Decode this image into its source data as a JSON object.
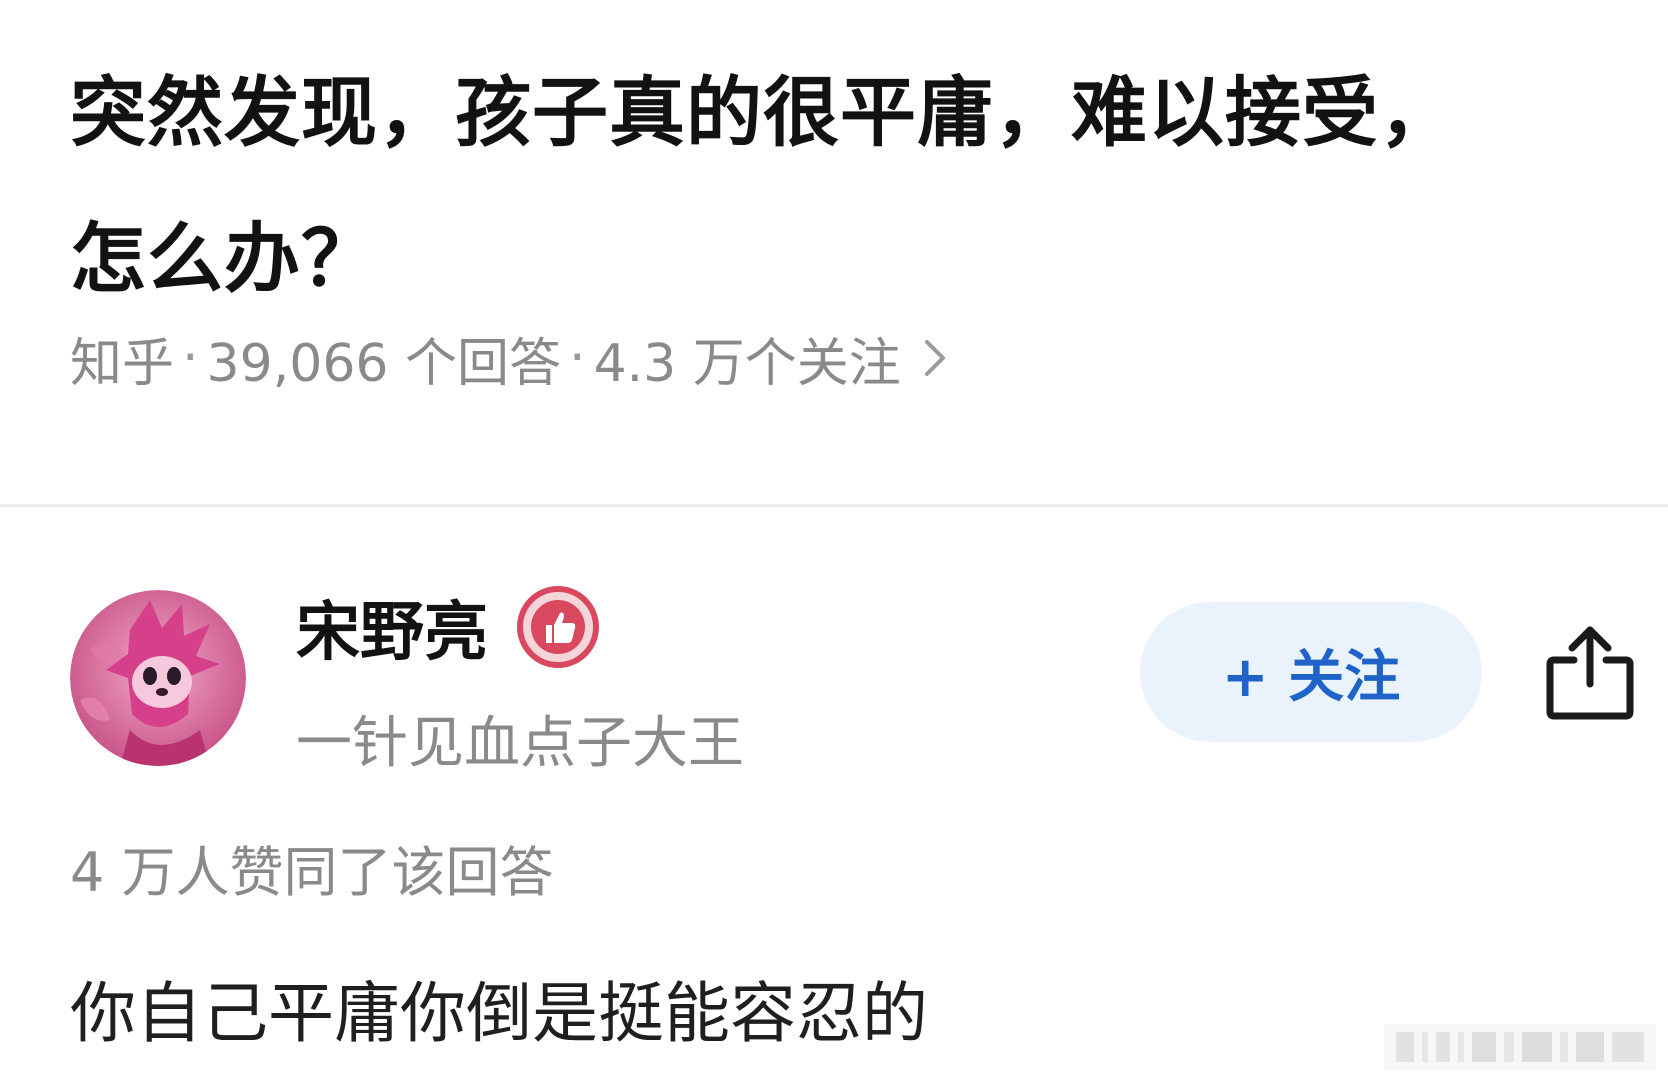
{
  "question": {
    "title": "突然发现，孩子真的很平庸，难以接受，怎么办？"
  },
  "meta": {
    "source": "知乎",
    "separator": "·",
    "answers": "39,066 个回答",
    "followers": "4.3 万个关注",
    "chevron_icon": "chevron-right-icon"
  },
  "author": {
    "name": "宋野亮",
    "badge_icon": "thumbs-up-badge-icon",
    "bio": "一针见血点子大王",
    "avatar_icon": "pink-hedgehog-avatar"
  },
  "actions": {
    "follow_label": "+ 关注",
    "share_icon": "share-icon"
  },
  "answer": {
    "likes": "4 万人赞同了该回答",
    "text": "你自己平庸你倒是挺能容忍的"
  },
  "colors": {
    "accent": "#1f63c9",
    "follow_bg": "#eaf2fc",
    "muted_text": "#8a8a8a",
    "badge": "#d9485f"
  }
}
